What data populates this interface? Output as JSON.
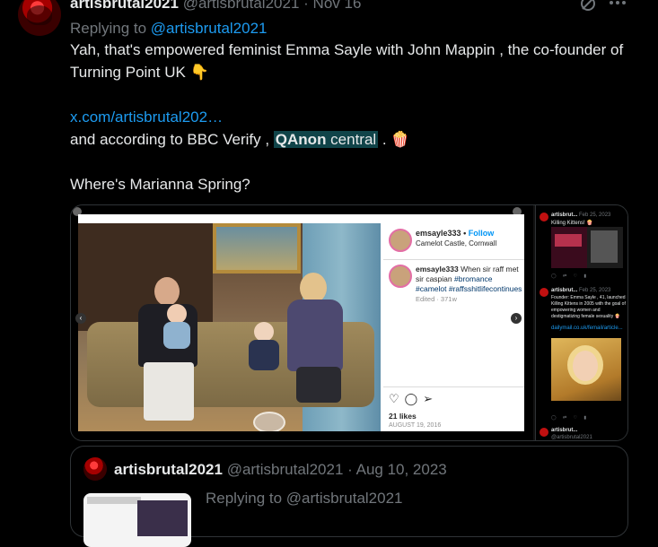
{
  "tweet": {
    "name": "artisbrutal2021",
    "handle": "@artisbrutal2021",
    "separator": "·",
    "date": "Nov 16",
    "replying_prefix": "Replying to ",
    "replying_to": "@artisbrutal2021",
    "line1": "Yah, that's empowered feminist Emma Sayle with John Mappin , the co-founder of Turning Point UK 👇",
    "link": "x.com/artisbrutal202…",
    "line2_pre": "and according to BBC Verify , ",
    "highlight_bold": "QAnon",
    "highlight_rest": " central",
    "line2_post": " . 🍿",
    "line3": "Where's Marianna Spring?",
    "icons": {
      "grok": "grok-icon",
      "more": "more-icon"
    }
  },
  "instagram": {
    "username": "emsayle333",
    "dot": "•",
    "follow": "Follow",
    "location": "Camelot Castle, Cornwall",
    "caption_user": "emsayle333",
    "caption_text": " When sir raff met sir caspian ",
    "tags": "#bromance #camelot #raffsshitlifecontinues",
    "edited": "Edited · 371w",
    "likes": "21 likes",
    "date": "AUGUST 19, 2016"
  },
  "twitter_panel": {
    "name": "artisbrut...",
    "date1": "Feb 25, 2023",
    "sub1": "Killing Kittens! 🍿",
    "date2": "Feb 25, 2023",
    "sub2": "Founder: Emma Sayle , 41, launched Killing Kittens in 2005 with the goal of empowering women and destigmatizing female sexuality 🍿",
    "link": "dailymail.co.uk/femail/article...",
    "bottom_name": "artisbrut...",
    "bottom_handle": "@artisbrutal2021"
  },
  "quote": {
    "name": "artisbrutal2021",
    "handle": "@artisbrutal2021",
    "separator": "·",
    "date": "Aug 10, 2023",
    "replying": "Replying to @artisbrutal2021"
  }
}
